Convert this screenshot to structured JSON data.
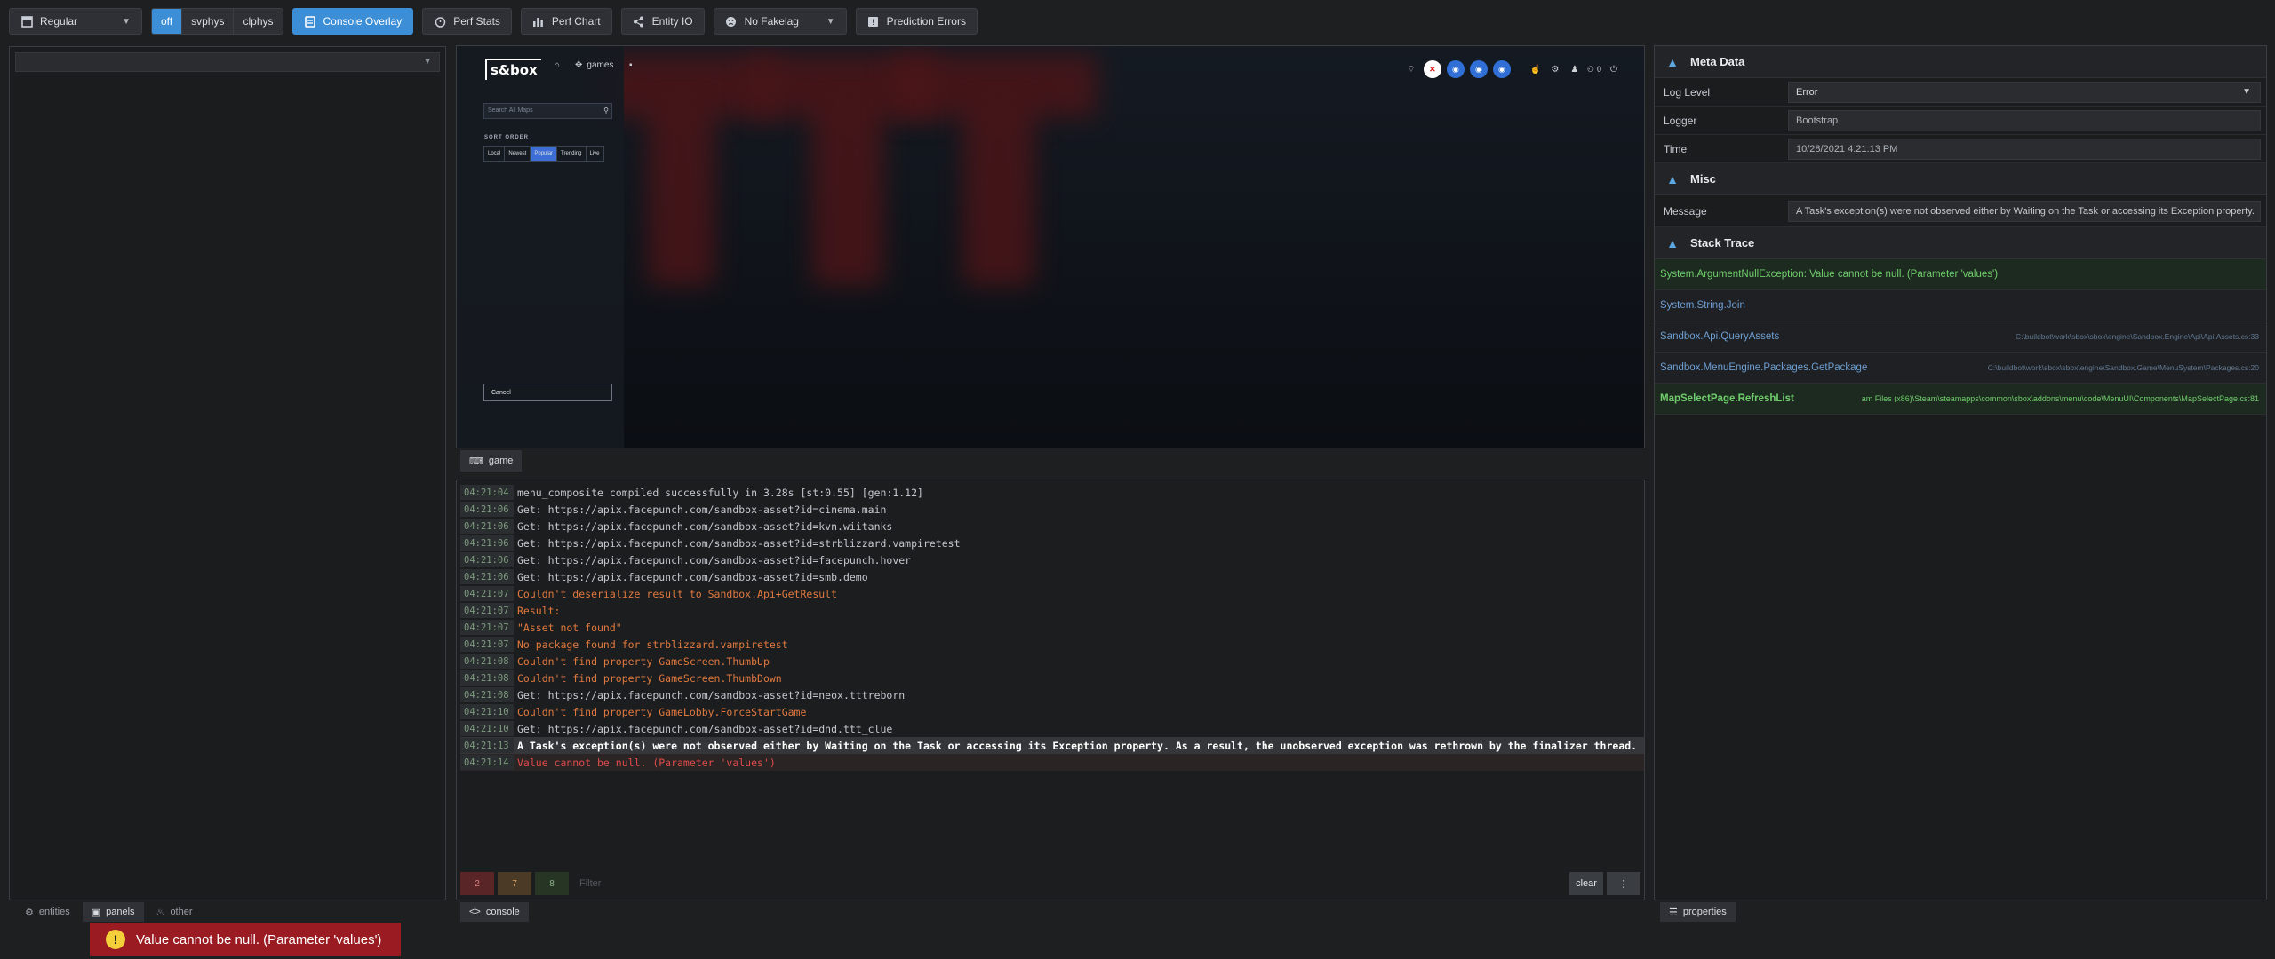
{
  "toolbar": {
    "mode_select": {
      "value": "Regular"
    },
    "physics": {
      "options": [
        "off",
        "svphys",
        "clphys"
      ],
      "active": "off"
    },
    "console_overlay": "Console Overlay",
    "perf_stats": "Perf Stats",
    "perf_chart": "Perf Chart",
    "entity_io": "Entity IO",
    "fakelag": {
      "value": "No Fakelag"
    },
    "prediction_errors": "Prediction Errors"
  },
  "left_tabs": [
    "entities",
    "panels",
    "other"
  ],
  "game": {
    "tab_label": "game",
    "logo": "s&box",
    "nav_games": "games",
    "search_placeholder": "Search All Maps",
    "sort_label": "SORT ORDER",
    "sort_options": [
      "Local",
      "Newest",
      "Popular",
      "Trending",
      "Live"
    ],
    "sort_active": "Popular",
    "cancel": "Cancel",
    "players_count": "0"
  },
  "console": {
    "tab_label": "console",
    "rows": [
      {
        "ts": "04:21:04",
        "msg": "menu_composite compiled successfully in 3.28s [st:0.55] [gen:1.12]",
        "level": "info"
      },
      {
        "ts": "04:21:06",
        "msg": "Get: https://apix.facepunch.com/sandbox-asset?id=cinema.main",
        "level": "info"
      },
      {
        "ts": "04:21:06",
        "msg": "Get: https://apix.facepunch.com/sandbox-asset?id=kvn.wiitanks",
        "level": "info"
      },
      {
        "ts": "04:21:06",
        "msg": "Get: https://apix.facepunch.com/sandbox-asset?id=strblizzard.vampiretest",
        "level": "info"
      },
      {
        "ts": "04:21:06",
        "msg": "Get: https://apix.facepunch.com/sandbox-asset?id=facepunch.hover",
        "level": "info"
      },
      {
        "ts": "04:21:06",
        "msg": "Get: https://apix.facepunch.com/sandbox-asset?id=smb.demo",
        "level": "info"
      },
      {
        "ts": "04:21:07",
        "msg": "Couldn't deserialize result to Sandbox.Api+GetResult",
        "level": "warn"
      },
      {
        "ts": "04:21:07",
        "msg": "Result:",
        "level": "warn"
      },
      {
        "ts": "04:21:07",
        "msg": "\"Asset not found\"",
        "level": "warn"
      },
      {
        "ts": "04:21:07",
        "msg": "No package found for strblizzard.vampiretest",
        "level": "warn"
      },
      {
        "ts": "04:21:08",
        "msg": "Couldn't find property GameScreen.ThumbUp",
        "level": "warn"
      },
      {
        "ts": "04:21:08",
        "msg": "Couldn't find property GameScreen.ThumbDown",
        "level": "warn"
      },
      {
        "ts": "04:21:08",
        "msg": "Get: https://apix.facepunch.com/sandbox-asset?id=neox.tttreborn",
        "level": "info"
      },
      {
        "ts": "04:21:10",
        "msg": "Couldn't find property GameLobby.ForceStartGame",
        "level": "warn"
      },
      {
        "ts": "04:21:10",
        "msg": "Get: https://apix.facepunch.com/sandbox-asset?id=dnd.ttt_clue",
        "level": "info"
      },
      {
        "ts": "04:21:13",
        "msg": "A Task's exception(s) were not observed either by Waiting on the Task or accessing its Exception property. As a result, the unobserved exception was rethrown by the finalizer thread. (Value ca",
        "level": "sel"
      },
      {
        "ts": "04:21:14",
        "msg": "Value cannot be null. (Parameter 'values')",
        "level": "err"
      }
    ],
    "counts": {
      "errors": "2",
      "warnings": "7",
      "info": "8"
    },
    "filter_placeholder": "Filter",
    "clear": "clear",
    "more": "⋮"
  },
  "properties": {
    "tab_label": "properties",
    "meta_title": "Meta Data",
    "log_level_label": "Log Level",
    "log_level_value": "Error",
    "logger_label": "Logger",
    "logger_value": "Bootstrap",
    "time_label": "Time",
    "time_value": "10/28/2021 4:21:13 PM",
    "misc_title": "Misc",
    "message_label": "Message",
    "message_value": "A Task's exception(s) were not observed either by Waiting on the Task or accessing its Exception property.",
    "stack_title": "Stack Trace",
    "trace": [
      {
        "method": "System.ArgumentNullException: Value cannot be null. (Parameter 'values')",
        "file": "",
        "kind": "first"
      },
      {
        "method": "System.String.Join",
        "file": "",
        "kind": "normal"
      },
      {
        "method": "Sandbox.Api.QueryAssets",
        "file": "C:\\buildbot\\work\\sbox\\sbox\\engine\\Sandbox.Engine\\Api\\Api.Assets.cs:33",
        "kind": "normal"
      },
      {
        "method": "Sandbox.MenuEngine.Packages.GetPackage",
        "file": "C:\\buildbot\\work\\sbox\\sbox\\engine\\Sandbox.Game\\MenuSystem\\Packages.cs:20",
        "kind": "normal"
      },
      {
        "method": "MapSelectPage.RefreshList",
        "file": "am Files (x86)\\Steam\\steamapps\\common\\sbox\\addons\\menu\\code\\MenuUI\\Components\\MapSelectPage.cs:81",
        "kind": "last"
      }
    ]
  },
  "toast": {
    "message": "Value cannot be null. (Parameter 'values')"
  },
  "colors": {
    "accent": "#3c8fd6",
    "error": "#e14b4b",
    "warning": "#e0793e",
    "toast_bg": "#9a1b22",
    "success": "#6fce6b"
  }
}
